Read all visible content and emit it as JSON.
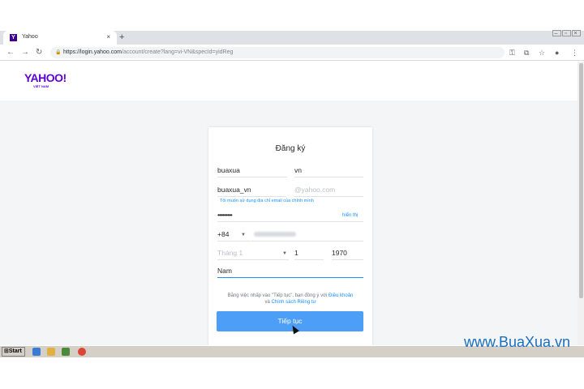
{
  "browser": {
    "tab_title": "Yahoo",
    "tab_favicon": "Y",
    "tab_close": "×",
    "new_tab": "+",
    "url_host": "https://login.yahoo.com",
    "url_path": "/account/create?lang=vi-VN&specId=yidReg"
  },
  "header": {
    "logo": "YAHOO!",
    "logo_sub": "VIỆT NAM"
  },
  "form": {
    "title": "Đăng ký",
    "first_name": "buaxua",
    "last_name": "vn",
    "username": "buaxua_vn",
    "email_domain": "@yahoo.com",
    "use_email_link": "Tôi muốn sử dụng địa chỉ email của chính mình",
    "password": "•••••••••",
    "show_password": "hiển thị",
    "country_code": "+84",
    "birth_month": "Tháng 1",
    "birth_day": "1",
    "birth_year": "1970",
    "gender": "Nam",
    "terms_prefix": "Bằng việc nhấp vào \"Tiếp tục\", bạn đồng ý với",
    "terms_link": "Điều khoản",
    "terms_and": "và",
    "privacy_link": "Chính sách Riêng tư",
    "continue_label": "Tiếp tục"
  },
  "taskbar": {
    "start_label": "Start"
  },
  "watermark": "www.BuaXua.vn",
  "colors": {
    "brand": "#5f01d1",
    "accent": "#188fff",
    "button": "#4d9ef7"
  }
}
